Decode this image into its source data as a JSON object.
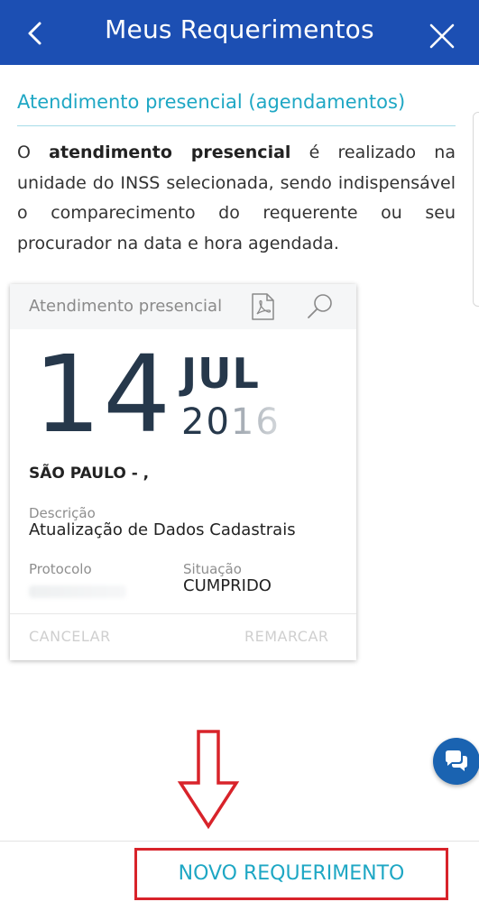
{
  "header": {
    "title": "Meus Requerimentos",
    "back_icon": "chevron-left-icon",
    "close_icon": "close-icon",
    "color": "#1c4fb3"
  },
  "section": {
    "title": "Atendimento presencial (agendamentos)",
    "intro_prefix": "O ",
    "intro_bold": "atendimento presencial",
    "intro_rest": " é realizado na unidade do INSS selecionada, sendo indispensável o comparecimento do requerente ou seu procurador na data e hora agendada."
  },
  "card": {
    "type": "Atendimento presencial",
    "pdf_icon": "pdf-icon",
    "search_icon": "search-icon",
    "day": "14",
    "month": "JUL",
    "year": "2016",
    "city": "SÃO PAULO - ,",
    "description_label": "Descrição",
    "description_value": "Atualização de Dados Cadastrais",
    "protocol_label": "Protocolo",
    "status_label": "Situação",
    "status_value": "CUMPRIDO",
    "cancel_label": "CANCELAR",
    "reschedule_label": "REMARCAR"
  },
  "chat_icon": "chat-icon",
  "new_request_label": "NOVO REQUERIMENTO",
  "colors": {
    "accent": "#1ea7c4",
    "highlight_box": "#d8232a",
    "fab": "#1a63b1"
  }
}
